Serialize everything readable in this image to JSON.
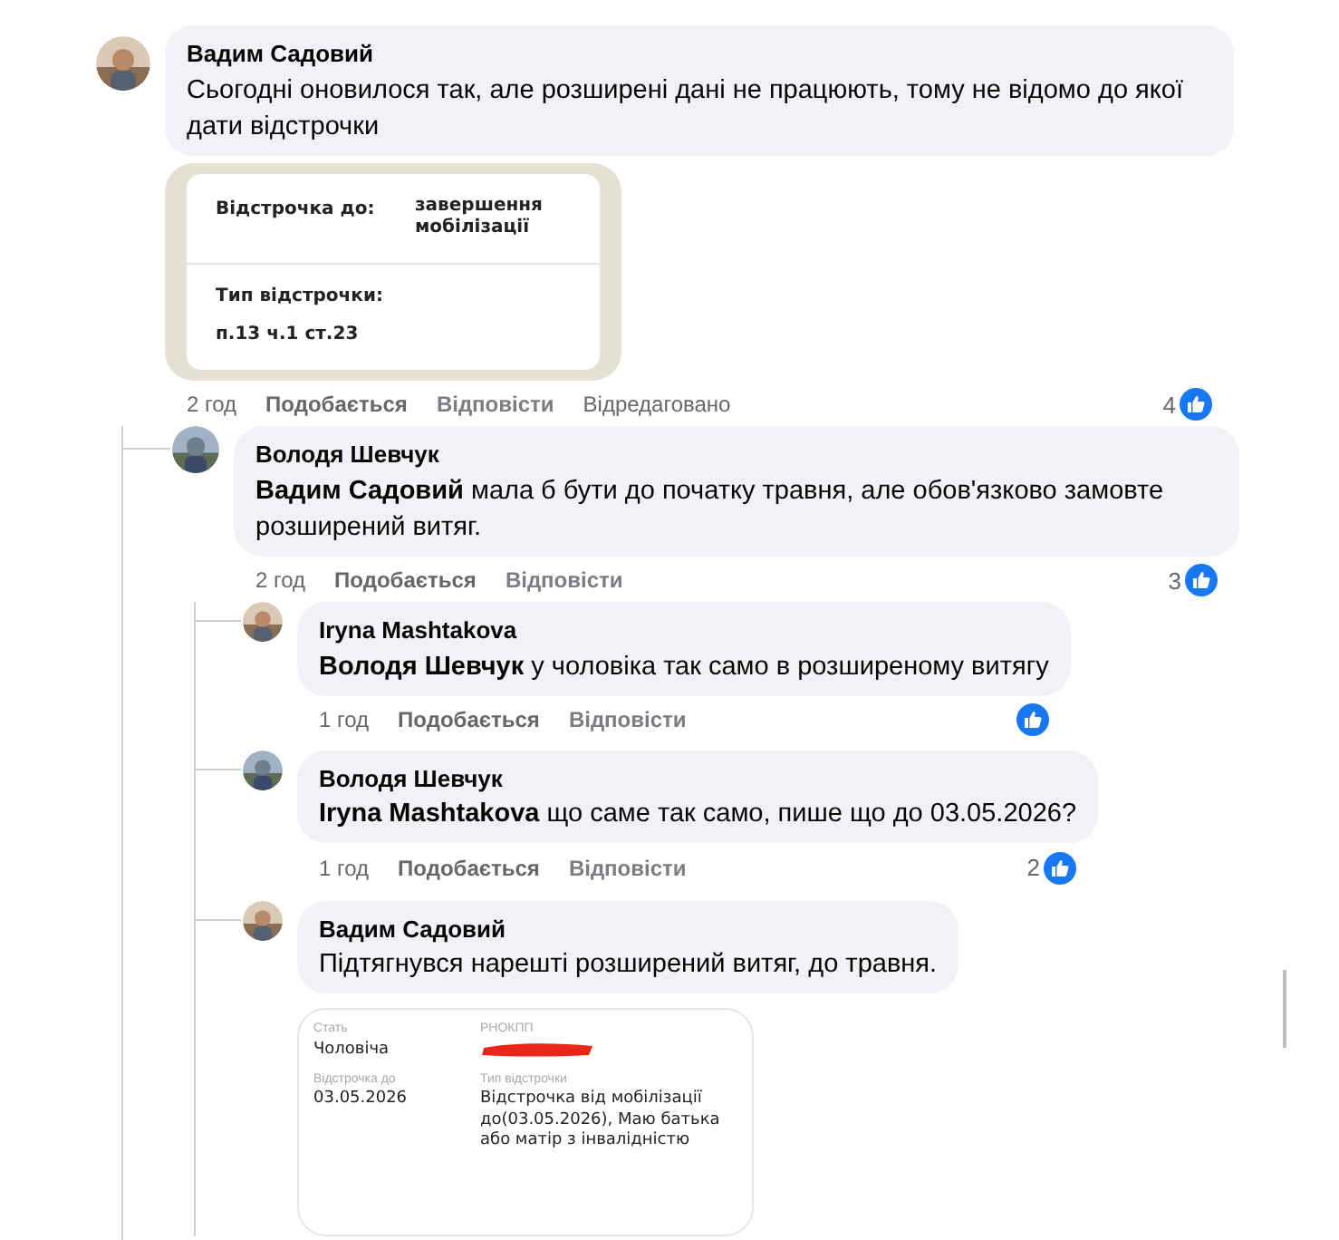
{
  "comments": [
    {
      "author": "Вадим Садовий",
      "text": "Сьогодні оновилося так, але розширені дані не працюють, тому не відомо до якої дати відстрочки",
      "attachment": {
        "kind": "deferral_card",
        "rows": [
          {
            "label": "Відстрочка до:",
            "value": "завершення мобілізації"
          },
          {
            "label": "Тип відстрочки:",
            "value": "п.13 ч.1 ст.23"
          }
        ]
      },
      "time": "2 год",
      "actions": [
        "Подобається",
        "Відповісти"
      ],
      "edited": "Відредаговано",
      "likes": "4",
      "reaction": true,
      "replies": [
        {
          "author": "Володя Шевчук",
          "mention": "Вадим Садовий",
          "text": "мала б бути до початку травня, але обов'язково замовте розширений витяг.",
          "time": "2 год",
          "actions": [
            "Подобається",
            "Відповісти"
          ],
          "likes": "3",
          "reaction": true,
          "replies": [
            {
              "author": "Iryna Mashtakova",
              "mention": "Володя Шевчук",
              "text": "у чоловіка так само в розширеному витягу",
              "time": "1 год",
              "actions": [
                "Подобається",
                "Відповісти"
              ],
              "reaction": true
            },
            {
              "author": "Володя Шевчук",
              "mention": "Iryna Mashtakova",
              "text": "що саме так само, пише що до 03.05.2026?",
              "time": "1 год",
              "actions": [
                "Подобається",
                "Відповісти"
              ],
              "likes": "2",
              "reaction": true
            },
            {
              "author": "Вадим Садовий",
              "text": "Підтягнувся нарешті розширений витяг, до травня.",
              "attachment": {
                "kind": "extract_card",
                "fields": [
                  {
                    "label": "Стать",
                    "value": "Чоловіча"
                  },
                  {
                    "label": "РНОКПП",
                    "redacted": true
                  },
                  {
                    "label": "Відстрочка до",
                    "value": "03.05.2026"
                  },
                  {
                    "label": "Тип відстрочки",
                    "value": "Відстрочка від мобілізації до(03.05.2026), Маю батька або матір з інвалідністю"
                  }
                ]
              }
            }
          ]
        }
      ]
    }
  ]
}
